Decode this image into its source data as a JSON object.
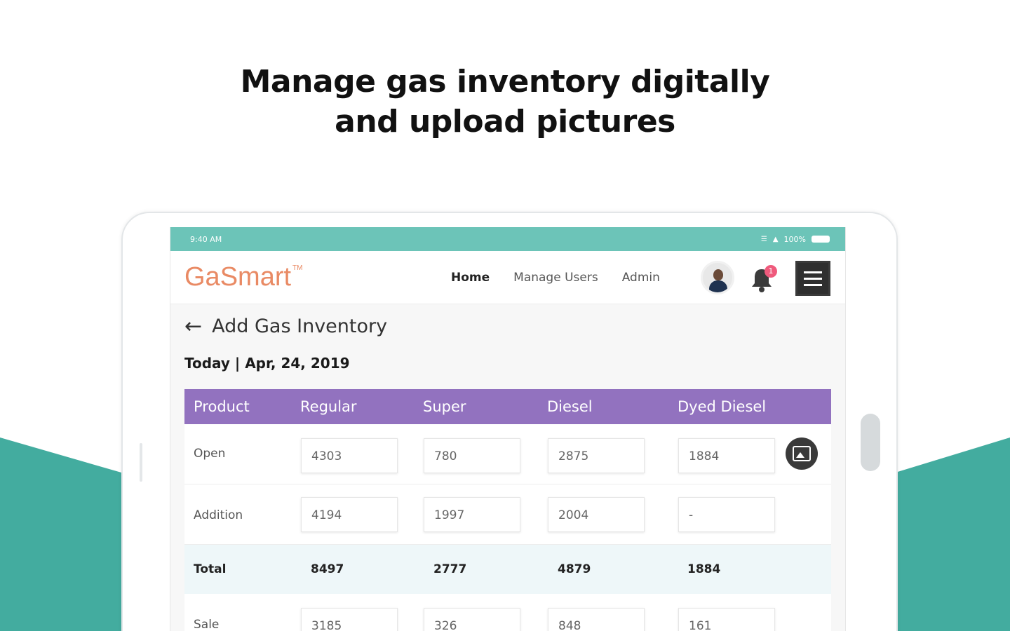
{
  "headline": {
    "line1": "Manage gas inventory digitally",
    "line2": "and upload pictures"
  },
  "colors": {
    "teal": "#43ac9f",
    "status_teal": "#6cc4b8",
    "table_header_purple": "#9272bf",
    "logo_orange": "#e98a64",
    "badge_pink": "#ef5a7c"
  },
  "status_bar": {
    "time": "9:40 AM",
    "battery": "100%"
  },
  "nav": {
    "logo": "GaSmart",
    "logo_mark": "TM",
    "links": [
      "Home",
      "Manage Users",
      "Admin"
    ],
    "notification_count": "1",
    "icons": [
      "avatar",
      "bell-icon",
      "hamburger-menu-icon"
    ]
  },
  "page": {
    "title": "Add Gas Inventory",
    "date_line": "Today | Apr, 24, 2019"
  },
  "table": {
    "headers": [
      "Product",
      "Regular",
      "Super",
      "Diesel",
      "Dyed Diesel"
    ],
    "rows": [
      {
        "label": "Open",
        "values": [
          "4303",
          "780",
          "2875",
          "1884"
        ]
      },
      {
        "label": "Addition",
        "values": [
          "4194",
          "1997",
          "2004",
          "-"
        ]
      },
      {
        "label": "Total",
        "values": [
          "8497",
          "2777",
          "4879",
          "1884"
        ]
      },
      {
        "label": "Sale",
        "values": [
          "3185",
          "326",
          "848",
          "161"
        ]
      }
    ]
  }
}
